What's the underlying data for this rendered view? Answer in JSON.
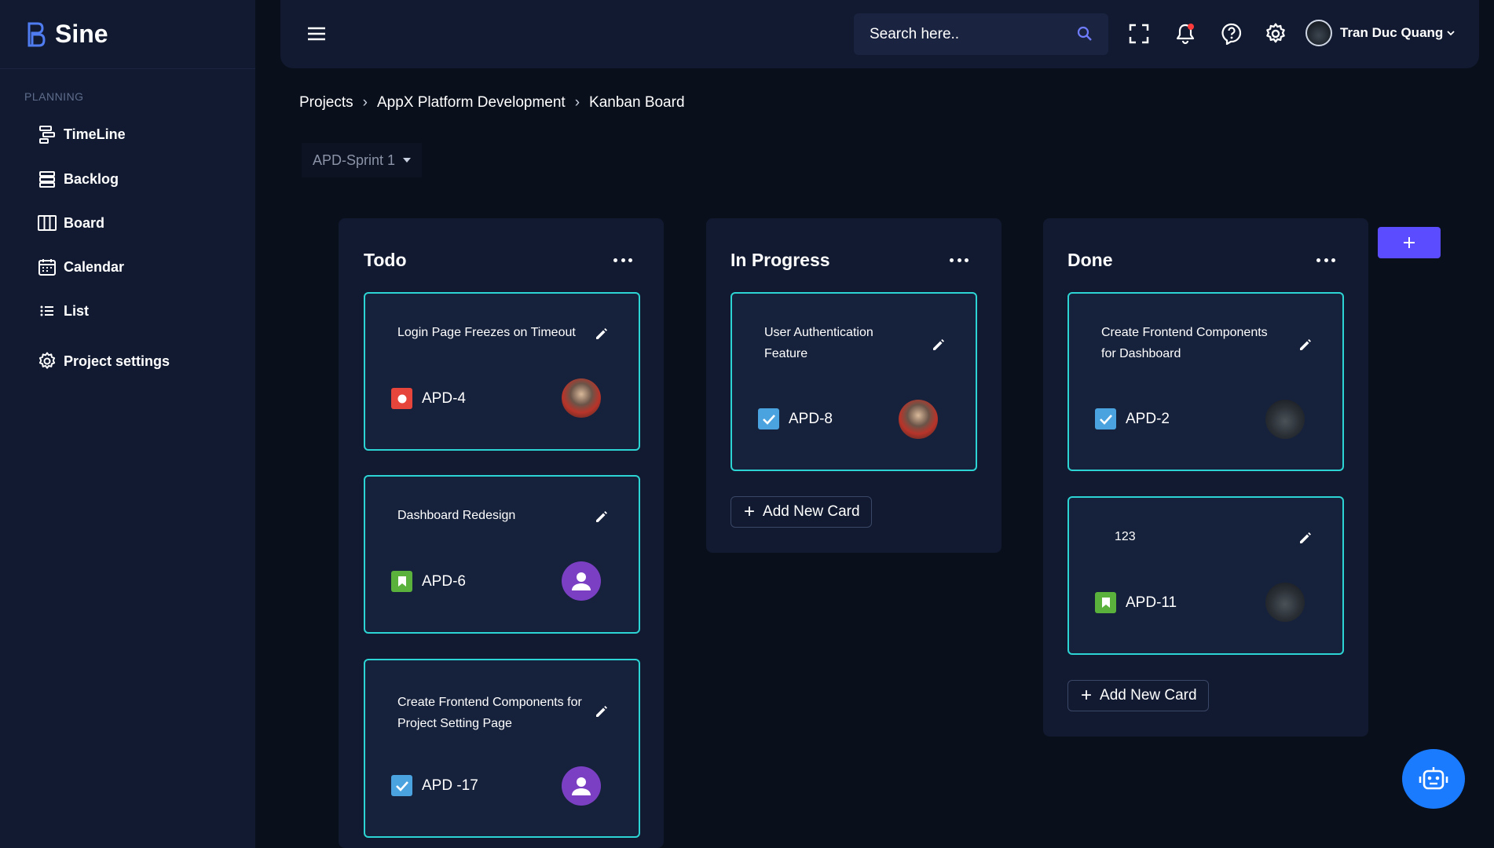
{
  "brand": {
    "name": "Sine"
  },
  "sidebar": {
    "section_label": "PLANNING",
    "items": [
      {
        "label": "TimeLine",
        "icon": "timeline-icon"
      },
      {
        "label": "Backlog",
        "icon": "backlog-icon"
      },
      {
        "label": "Board",
        "icon": "board-icon"
      },
      {
        "label": "Calendar",
        "icon": "calendar-icon"
      },
      {
        "label": "List",
        "icon": "list-icon"
      },
      {
        "label": "Project settings",
        "icon": "gear-icon"
      }
    ]
  },
  "topbar": {
    "search_placeholder": "Search here..",
    "user_name": "Tran Duc Quang"
  },
  "breadcrumb": [
    "Projects",
    "AppX Platform Development",
    "Kanban Board"
  ],
  "sprint": {
    "selected": "APD-Sprint 1"
  },
  "colors": {
    "accent": "#5b4dff",
    "card_border": "#2dd4d4",
    "bug": "#e5453a",
    "story": "#5ab13c",
    "task": "#4aa3df"
  },
  "columns": [
    {
      "title": "Todo",
      "cards": [
        {
          "title": "Login Page Freezes on Timeout",
          "key": "APD-4",
          "type": "bug-icon",
          "assignee": "photo"
        },
        {
          "title": "Dashboard Redesign",
          "key": "APD-6",
          "type": "story-icon",
          "assignee": "person"
        },
        {
          "title": "Create Frontend Components for Project Setting Page",
          "key": "APD -17",
          "type": "task-icon",
          "assignee": "person"
        }
      ]
    },
    {
      "title": "In Progress",
      "cards": [
        {
          "title": "User Authentication Feature",
          "key": "APD-8",
          "type": "task-icon",
          "assignee": "photo"
        }
      ],
      "add_label": "Add New Card"
    },
    {
      "title": "Done",
      "cards": [
        {
          "title": "Create Frontend Components for Dashboard",
          "key": "APD-2",
          "type": "task-icon",
          "assignee": "photo-dark"
        },
        {
          "title": "123",
          "key": "APD-11",
          "type": "story-icon",
          "assignee": "photo-dark"
        }
      ],
      "add_label": "Add New Card"
    }
  ],
  "add_column_label": "+"
}
